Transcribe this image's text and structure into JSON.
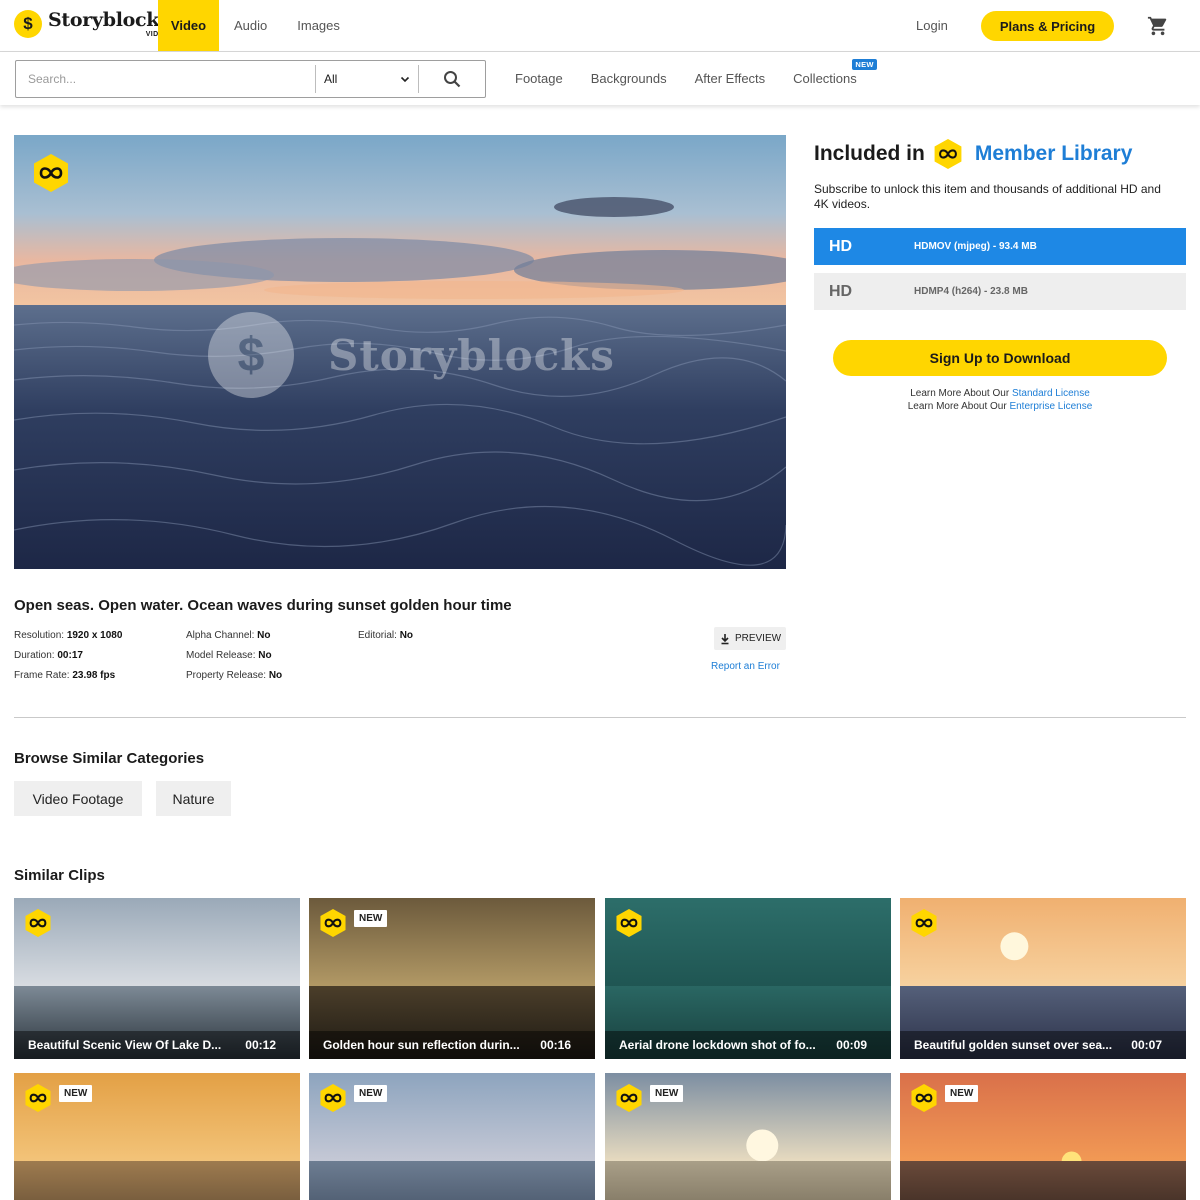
{
  "header": {
    "logo_text": "Storyblocks",
    "logo_sub": "VIDEO",
    "logo_mark": "$",
    "nav": [
      {
        "label": "Video",
        "active": true
      },
      {
        "label": "Audio",
        "active": false
      },
      {
        "label": "Images",
        "active": false
      }
    ],
    "login_label": "Login",
    "plans_label": "Plans & Pricing",
    "cart_icon": "cart-icon"
  },
  "search": {
    "placeholder": "Search...",
    "category_value": "All",
    "subnav": [
      "Footage",
      "Backgrounds",
      "After Effects",
      "Collections"
    ],
    "new_tag": "NEW"
  },
  "player": {
    "watermark_text": "Storyblocks",
    "watermark_mark": "$"
  },
  "clip": {
    "title": "Open seas. Open water. Ocean waves during sunset golden hour time",
    "specs": {
      "resolution": {
        "label": "Resolution:",
        "value": "1920 x 1080"
      },
      "duration": {
        "label": "Duration:",
        "value": "00:17"
      },
      "frame_rate": {
        "label": "Frame Rate:",
        "value": "23.98 fps"
      },
      "alpha": {
        "label": "Alpha Channel:",
        "value": "No"
      },
      "model": {
        "label": "Model Release:",
        "value": "No"
      },
      "property": {
        "label": "Property Release:",
        "value": "No"
      },
      "editorial": {
        "label": "Editorial:",
        "value": "No"
      }
    },
    "preview_label": "PREVIEW",
    "report_label": "Report an Error"
  },
  "panel": {
    "included_label": "Included in",
    "member_label": "Member Library",
    "subscribe_text": "Subscribe to unlock this item and thousands of additional HD and 4K videos.",
    "formats": [
      {
        "quality": "HD",
        "format": "HDMOV (mjpeg) - 93.4 MB",
        "selected": true
      },
      {
        "quality": "HD",
        "format": "HDMP4 (h264) - 23.8 MB",
        "selected": false
      }
    ],
    "signup_label": "Sign Up to Download",
    "license_prefix": "Learn More About Our",
    "standard_license": "Standard License",
    "enterprise_license": "Enterprise License"
  },
  "categories": {
    "heading": "Browse Similar Categories",
    "items": [
      "Video Footage",
      "Nature"
    ]
  },
  "similar": {
    "heading": "Similar Clips",
    "clips": [
      {
        "title": "Beautiful Scenic View Of Lake D...",
        "duration": "00:12",
        "new": false
      },
      {
        "title": "Golden hour sun reflection durin...",
        "duration": "00:16",
        "new": true
      },
      {
        "title": "Aerial drone lockdown shot of fo...",
        "duration": "00:09",
        "new": false
      },
      {
        "title": "Beautiful golden sunset over sea...",
        "duration": "00:07",
        "new": false
      },
      {
        "title": "",
        "duration": "",
        "new": true
      },
      {
        "title": "",
        "duration": "",
        "new": true
      },
      {
        "title": "",
        "duration": "",
        "new": true
      },
      {
        "title": "",
        "duration": "",
        "new": true
      }
    ],
    "new_label": "NEW"
  },
  "colors": {
    "brand_yellow": "#ffd600",
    "accent_blue": "#1e88e5",
    "link_blue": "#1e7ed6"
  }
}
